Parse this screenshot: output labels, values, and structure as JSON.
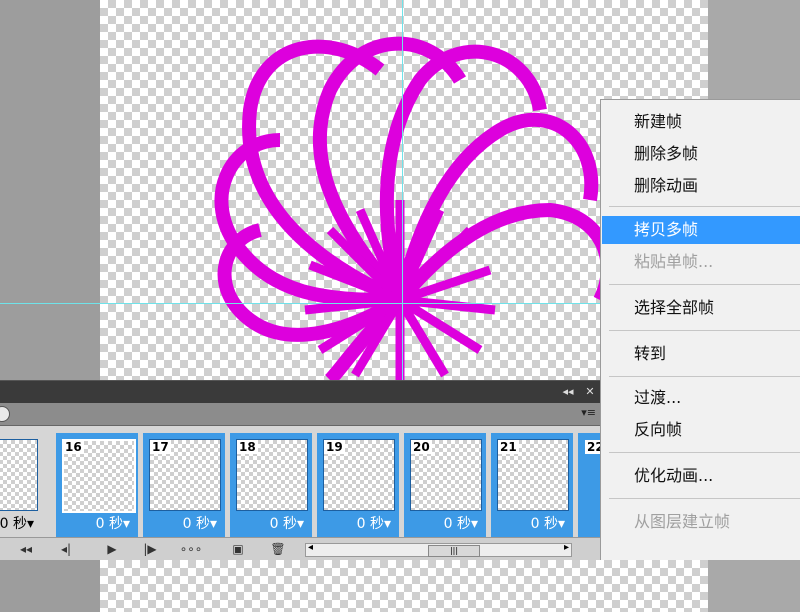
{
  "canvas": {
    "checker_light": "#ffffff",
    "checker_dark": "#cfcfcf",
    "guide_color": "#6fe3ea",
    "art_color": "#dd00dd"
  },
  "context_menu": {
    "items": [
      {
        "label": "新建帧",
        "state": "normal"
      },
      {
        "label": "删除多帧",
        "state": "normal"
      },
      {
        "label": "删除动画",
        "state": "normal"
      },
      {
        "label": "拷贝多帧",
        "state": "highlighted"
      },
      {
        "label": "粘贴单帧...",
        "state": "disabled"
      },
      {
        "label": "选择全部帧",
        "state": "normal"
      },
      {
        "label": "转到",
        "state": "normal"
      },
      {
        "label": "过渡...",
        "state": "normal"
      },
      {
        "label": "反向帧",
        "state": "normal"
      },
      {
        "label": "优化动画...",
        "state": "normal"
      },
      {
        "label": "从图层建立帧",
        "state": "disabled"
      }
    ],
    "highlight_color": "#3399ff"
  },
  "animation_panel": {
    "title_controls": [
      "◂◂",
      "✕"
    ],
    "frames": [
      {
        "number": "",
        "delay": "0 秒▾"
      },
      {
        "number": "16",
        "delay": "0 秒▾"
      },
      {
        "number": "17",
        "delay": "0 秒▾"
      },
      {
        "number": "18",
        "delay": "0 秒▾"
      },
      {
        "number": "19",
        "delay": "0 秒▾"
      },
      {
        "number": "20",
        "delay": "0 秒▾"
      },
      {
        "number": "21",
        "delay": "0 秒▾"
      },
      {
        "number": "22",
        "delay": ""
      }
    ],
    "selected_color": "#3d9ae6",
    "toolbar": {
      "first_frame": "◂◂",
      "prev_frame": "◂|",
      "play": "▶",
      "next_frame": "|▶",
      "tween": "∘∘∘",
      "new_frame": "▣",
      "delete": "🗑",
      "scroll_left": "◂",
      "scroll_right": "▸",
      "scroll_grip": "|||"
    },
    "panel_menu": "▾≡"
  }
}
